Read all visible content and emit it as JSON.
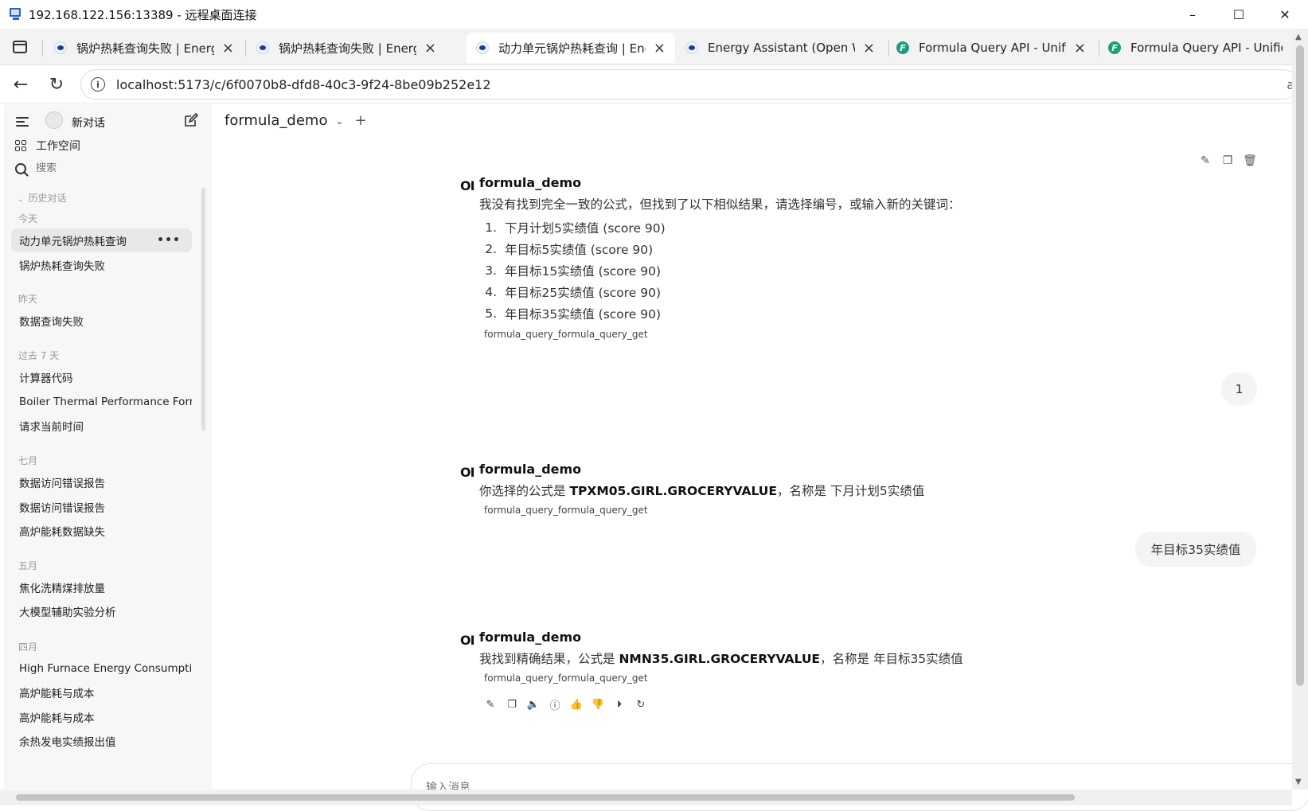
{
  "window": {
    "title": "192.168.122.156:13389 - 远程桌面连接",
    "controls": [
      "–",
      "☐",
      "✕"
    ]
  },
  "tabs": [
    {
      "label": "锅炉热耗查询失败 | Energy A",
      "icon": "openwebui-icon",
      "active": false
    },
    {
      "label": "锅炉热耗查询失败 | Energy A",
      "icon": "openwebui-icon",
      "active": false
    },
    {
      "label": "动力单元锅炉热耗查询 | Ener",
      "icon": "openwebui-icon",
      "active": true
    },
    {
      "label": "Energy Assistant (Open Web",
      "icon": "openwebui-icon",
      "active": false
    },
    {
      "label": "Formula Query API - Unified",
      "icon": "fastapi-icon",
      "active": false
    },
    {
      "label": "Formula Query API - Unified",
      "icon": "fastapi-icon",
      "active": false
    }
  ],
  "address": {
    "url": "localhost:5173/c/6f0070b8-dfd8-40c3-9f24-8be09b252e12",
    "right_glyph": "a"
  },
  "sidebar": {
    "new_chat": "新对话",
    "workspace": "工作空间",
    "search_placeholder": "搜索",
    "history_label": "历史对话",
    "sections": [
      {
        "label": "今天",
        "items": [
          "动力单元锅炉热耗查询",
          "锅炉热耗查询失败"
        ]
      },
      {
        "label": "昨天",
        "items": [
          "数据查询失败"
        ]
      },
      {
        "label": "过去 7 天",
        "items": [
          "计算器代码",
          "Boiler Thermal Performance Forn",
          "请求当前时间"
        ]
      },
      {
        "label": "七月",
        "items": [
          "数据访问错误报告",
          "数据访问错误报告",
          "高炉能耗数据缺失"
        ]
      },
      {
        "label": "五月",
        "items": [
          "焦化洗精煤排放量",
          "大模型辅助实验分析"
        ]
      },
      {
        "label": "四月",
        "items": [
          "High Furnace Energy Consumptic",
          "高炉能耗与成本",
          "高炉能耗与成本",
          "余热发电实绩报出值"
        ]
      }
    ],
    "more_glyph": "•••"
  },
  "main": {
    "model": "formula_demo",
    "messages": [
      {
        "role": "assistant",
        "name": "formula_demo",
        "text": "我没有找到完全一致的公式，但找到了以下相似结果，请选择编号，或输入新的关键词：",
        "options": [
          {
            "num": "1.",
            "text": "下月计划5实绩值 (score 90)"
          },
          {
            "num": "2.",
            "text": "年目标5实绩值 (score 90)"
          },
          {
            "num": "3.",
            "text": "年目标15实绩值 (score 90)"
          },
          {
            "num": "4.",
            "text": "年目标25实绩值 (score 90)"
          },
          {
            "num": "5.",
            "text": "年目标35实绩值 (score 90)"
          }
        ],
        "tool": "formula_query_formula_query_get"
      },
      {
        "role": "user",
        "text": "1"
      },
      {
        "role": "assistant",
        "name": "formula_demo",
        "pre": "你选择的公式是 ",
        "code": "TPXM05.GIRL.GROCERYVALUE",
        "post": "，名称是 下月计划5实绩值",
        "tool": "formula_query_formula_query_get"
      },
      {
        "role": "user",
        "text": "年目标35实绩值"
      },
      {
        "role": "assistant",
        "name": "formula_demo",
        "pre": "我找到精确结果，公式是 ",
        "code": "NMN35.GIRL.GROCERYVALUE",
        "post": "，名称是 年目标35实绩值",
        "tool": "formula_query_formula_query_get"
      }
    ],
    "composer_placeholder": "输入消息",
    "logo_text": "OI"
  }
}
